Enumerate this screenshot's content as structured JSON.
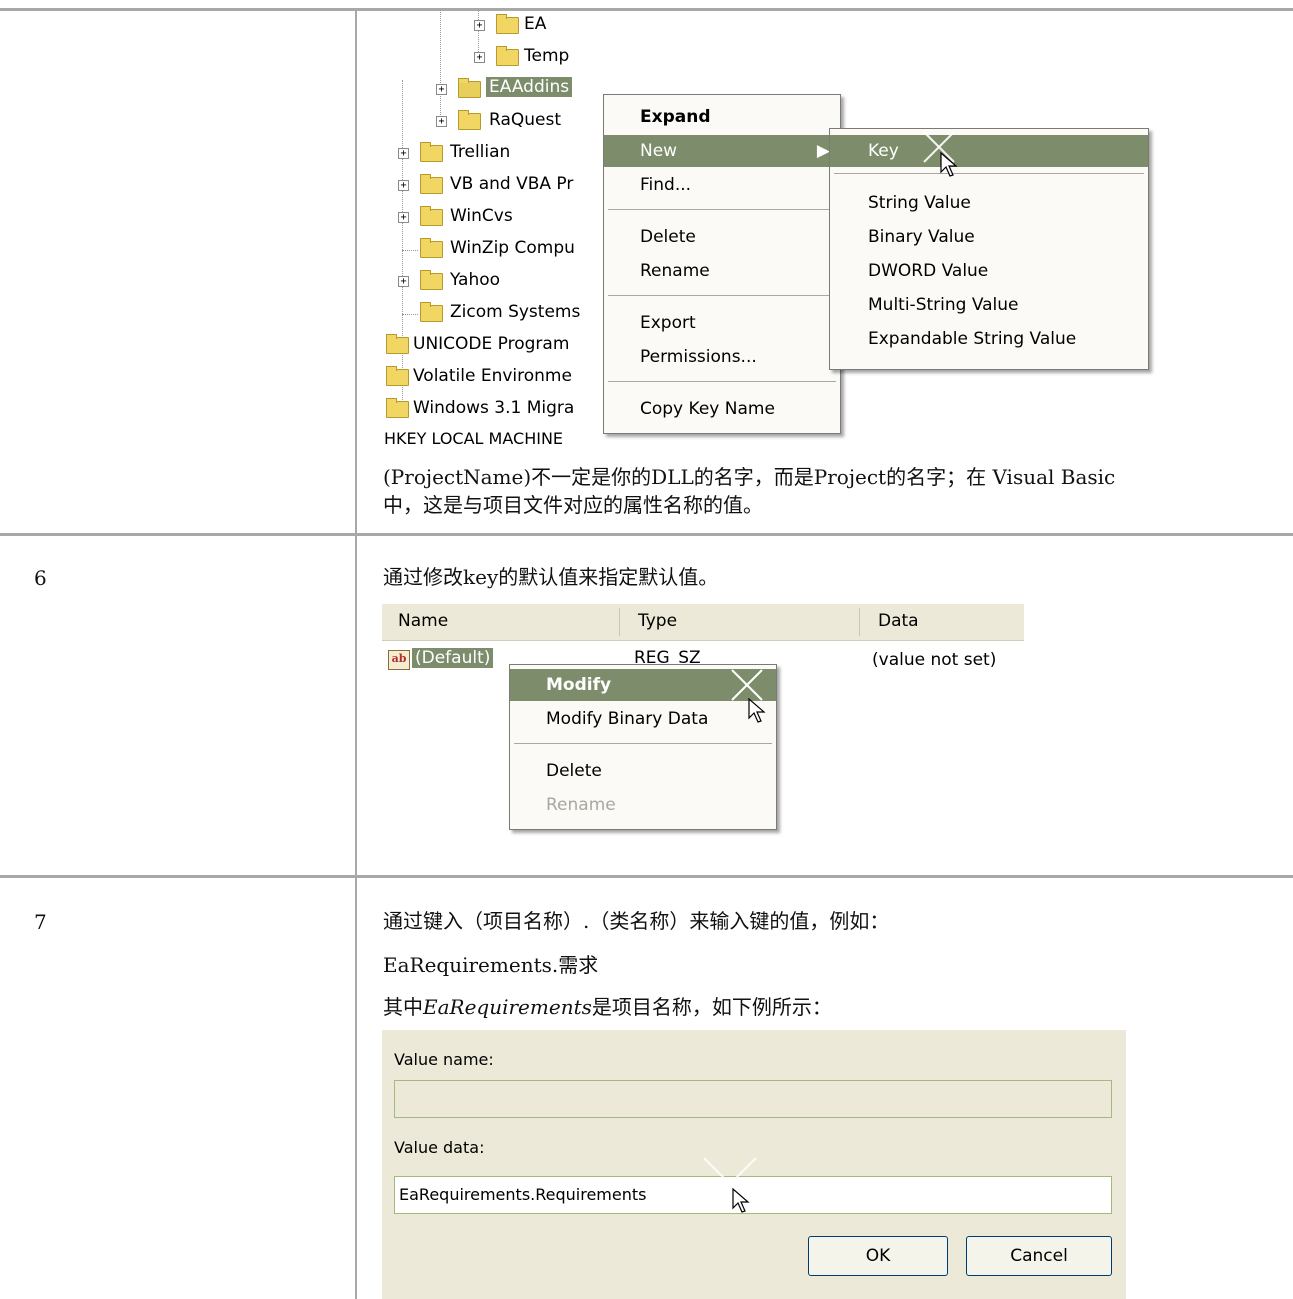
{
  "row5": {
    "tree": {
      "items": [
        {
          "label": "EA",
          "expander": true
        },
        {
          "label": "Temp",
          "expander": true
        },
        {
          "label": "EAAddins",
          "expander": true
        },
        {
          "label": "RaQuest",
          "expander": true
        },
        {
          "label": "Trellian",
          "expander": true
        },
        {
          "label": "VB and VBA Pr",
          "expander": true
        },
        {
          "label": "WinCvs",
          "expander": true
        },
        {
          "label": "WinZip Compu",
          "expander": false
        },
        {
          "label": "Yahoo",
          "expander": true
        },
        {
          "label": "Zicom Systems",
          "expander": false
        },
        {
          "label": "UNICODE Program",
          "expander": false
        },
        {
          "label": "Volatile Environme",
          "expander": false
        },
        {
          "label": "Windows 3.1 Migra",
          "expander": false
        }
      ],
      "root": "HKEY  LOCAL  MACHINE"
    },
    "context_menu": {
      "items": [
        "Expand",
        "New",
        "Find...",
        "Delete",
        "Rename",
        "Export",
        "Permissions...",
        "Copy Key Name"
      ]
    },
    "submenu": {
      "items": [
        "Key",
        "String Value",
        "Binary Value",
        "DWORD Value",
        "Multi-String Value",
        "Expandable String Value"
      ]
    },
    "note_line1": "(ProjectName)不一定是你的DLL的名字，而是Project的名字；在 Visual Basic",
    "note_line2": "中，这是与项目文件对应的属性名称的值。"
  },
  "row6": {
    "step": "6",
    "text": "通过修改key的默认值来指定默认值。",
    "list_header": {
      "name": "Name",
      "type": "Type",
      "data": "Data"
    },
    "row": {
      "name": "(Default)",
      "type": "REG_SZ",
      "data": "(value not set)"
    },
    "context_menu": {
      "items": [
        "Modify",
        "Modify Binary Data",
        "Delete",
        "Rename"
      ]
    }
  },
  "row7": {
    "step": "7",
    "text1": "通过键入（项目名称）.（类名称）来输入键的值，例如：",
    "text2": "EaRequirements.需求",
    "text3_prefix": "其中",
    "text3_em": "EaRequirements",
    "text3_suffix": "是项目名称，如下例所示：",
    "dialog": {
      "value_name_label": "Value name:",
      "value_name": "",
      "value_data_label": "Value data:",
      "value_data": "EaRequirements.Requirements",
      "ok": "OK",
      "cancel": "Cancel"
    }
  }
}
